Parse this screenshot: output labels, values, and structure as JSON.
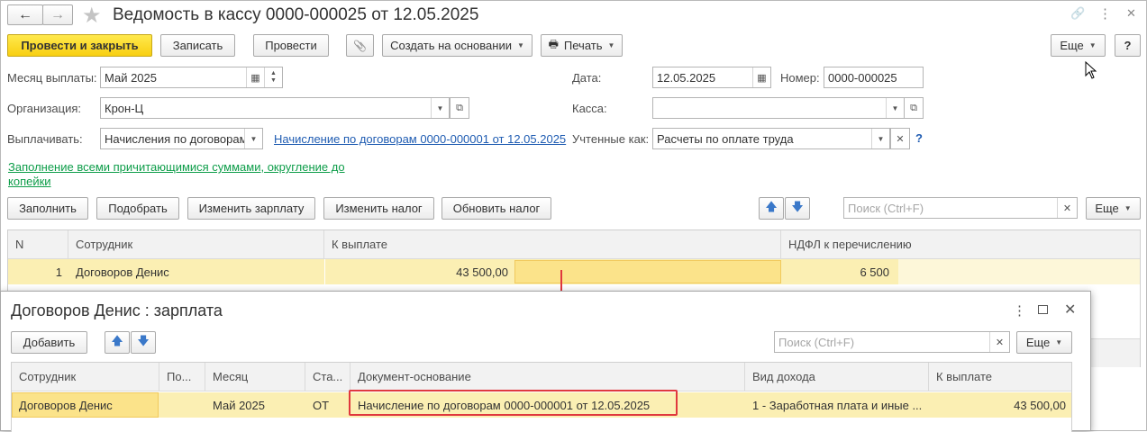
{
  "window": {
    "title": "Ведомость в кассу 0000-000025 от 12.05.2025",
    "nav_back": "←",
    "nav_forward": "→",
    "star": "★",
    "link_icon": "🔗",
    "more_icon": "⋮",
    "close_icon": "✕"
  },
  "toolbar": {
    "post_close": "Провести и закрыть",
    "write": "Записать",
    "post": "Провести",
    "attach_icon": "📎",
    "create_based": "Создать на основании",
    "print": "Печать",
    "more": "Еще",
    "help": "?"
  },
  "form": {
    "month_label": "Месяц выплаты:",
    "month_value": "Май 2025",
    "date_label": "Дата:",
    "date_value": "12.05.2025",
    "number_label": "Номер:",
    "number_value": "0000-000025",
    "org_label": "Организация:",
    "org_value": "Крон-Ц",
    "cash_label": "Касса:",
    "cash_value": "",
    "pay_label": "Выплачивать:",
    "pay_value": "Начисления по договорам",
    "pay_link": "Начисление по договорам 0000-000001 от 12.05.2025",
    "accounted_label": "Учтенные как:",
    "accounted_value": "Расчеты по оплате труда",
    "accounted_help": "?",
    "fill_link": "Заполнение всеми причитающимися суммами, округление до копейки"
  },
  "table_toolbar": {
    "fill": "Заполнить",
    "select": "Подобрать",
    "change_salary": "Изменить зарплату",
    "change_tax": "Изменить налог",
    "update_tax": "Обновить налог",
    "search_placeholder": "Поиск (Ctrl+F)",
    "more": "Еще"
  },
  "table": {
    "columns": [
      "N",
      "Сотрудник",
      "К выплате",
      "НДФЛ к перечислению"
    ],
    "rows": [
      {
        "n": "1",
        "employee": "Договоров Денис",
        "amount": "43 500,00",
        "ndfl": "6 500"
      }
    ]
  },
  "subwindow": {
    "title": "Договоров Денис : зарплата",
    "add": "Добавить",
    "search_placeholder": "Поиск (Ctrl+F)",
    "more": "Еще",
    "columns": [
      "Сотрудник",
      "По...",
      "Месяц",
      "Ста...",
      "Документ-основание",
      "Вид дохода",
      "К выплате"
    ],
    "rows": [
      {
        "employee": "Договоров Денис",
        "po": "",
        "month": "Май 2025",
        "status": "ОТ",
        "document": "Начисление по договорам 0000-000001 от 12.05.2025",
        "income": "1 - Заработная плата и иные ...",
        "amount": "43 500,00"
      }
    ]
  },
  "colors": {
    "accent_yellow": "#f8cf11",
    "row_highlight": "#fbefb3",
    "link_blue": "#1f5cb2",
    "link_green": "#0d9d49",
    "annotation_red": "#e0383e"
  }
}
